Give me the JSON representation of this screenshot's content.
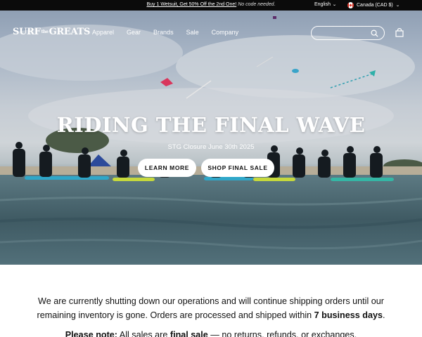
{
  "announcement": {
    "promo_link": "Buy 1 Wetsuit, Get 50% Off the 2nd One!",
    "promo_note": "No code needed.",
    "language": "English",
    "region": "Canada (CAD $)"
  },
  "header": {
    "logo_left": "SURF",
    "logo_mid": "the",
    "logo_right": "GREATS",
    "nav": [
      "Apparel",
      "Gear",
      "Brands",
      "Sale",
      "Company"
    ],
    "search_placeholder": ""
  },
  "hero": {
    "title": "RIDING THE FINAL WAVE",
    "subtitle": "STG Closure June 30th 2025",
    "learn_more": "LEARN MORE",
    "shop_final_sale": "SHOP FINAL SALE"
  },
  "content": {
    "para_1": "We are currently shutting down our operations and will continue shipping orders until our remaining inventory is gone. Orders are processed and shipped within ",
    "para_bold": "7 business days",
    "para_end": ".",
    "note_label": "Please note:",
    "note_1": " All sales are ",
    "note_bold": "final sale",
    "note_2": " — no returns, refunds, or exchanges."
  },
  "icons": {
    "search": "search-icon",
    "cart": "shopping-bag-icon",
    "flag": "canada-flag-icon",
    "chevron": "chevron-down-icon"
  },
  "colors": {
    "announcement_bg": "#0b0b0b",
    "button_bg": "#ffffff",
    "text": "#111111"
  }
}
